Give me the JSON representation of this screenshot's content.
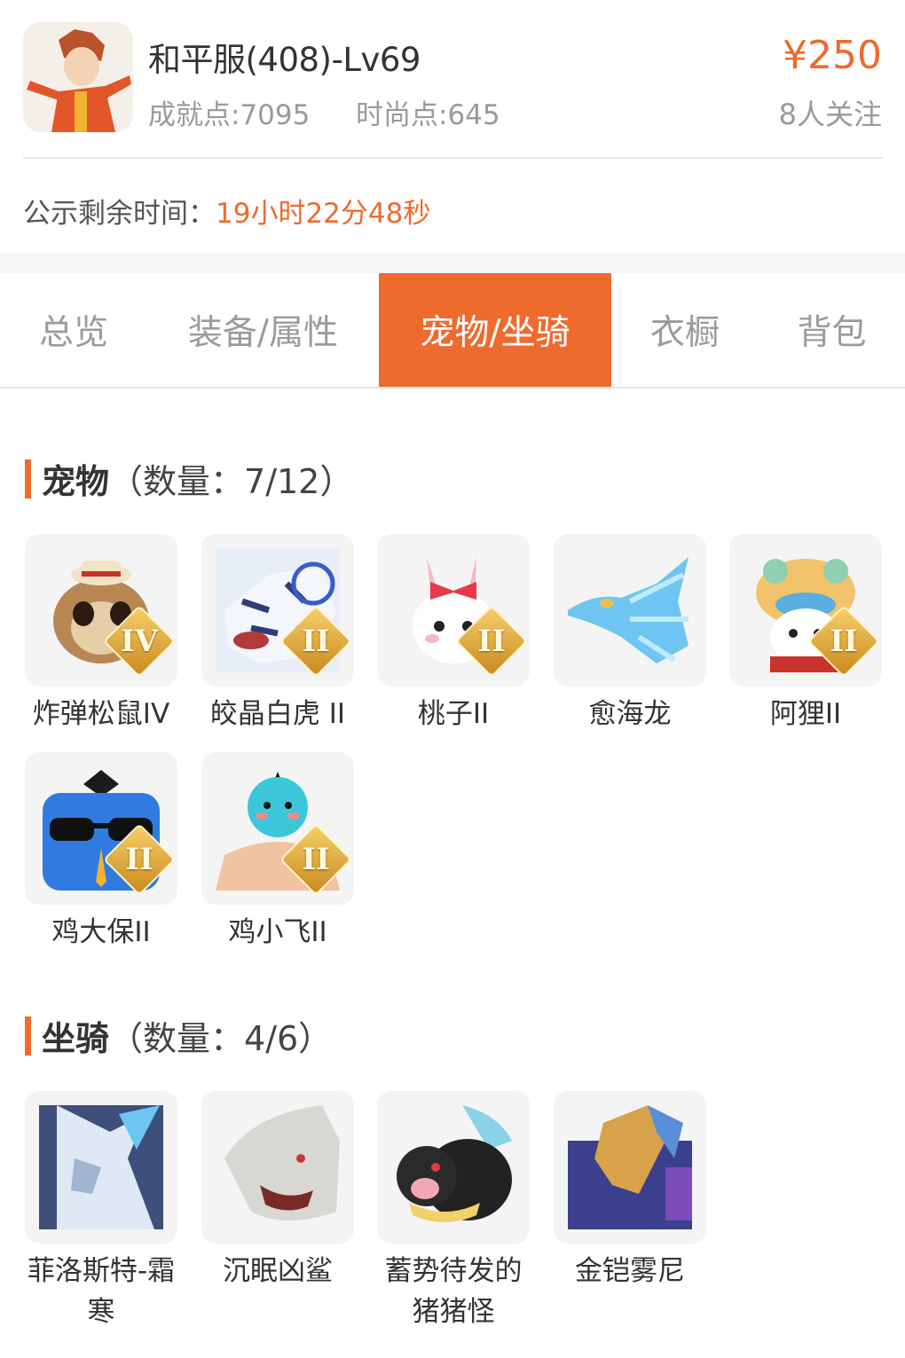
{
  "header": {
    "title": "和平服(408)-Lv69",
    "achievement": "成就点:7095",
    "fashion": "时尚点:645",
    "price": "¥250",
    "followers": "8人关注"
  },
  "countdown": {
    "label": "公示剩余时间：",
    "value": "19小时22分48秒"
  },
  "tabs": [
    {
      "label": "总览",
      "active": false
    },
    {
      "label": "装备/属性",
      "active": false
    },
    {
      "label": "宠物/坐骑",
      "active": true
    },
    {
      "label": "衣橱",
      "active": false
    },
    {
      "label": "背包",
      "active": false
    }
  ],
  "pets": {
    "title": "宠物",
    "count": "（数量：7/12）",
    "items": [
      {
        "name": "炸弹松鼠IV",
        "badge": "IV",
        "icon": "squirrel-icon"
      },
      {
        "name": "皎晶白虎 II",
        "badge": "II",
        "icon": "white-tiger-icon"
      },
      {
        "name": "桃子II",
        "badge": "II",
        "icon": "bunny-icon"
      },
      {
        "name": "愈海龙",
        "badge": "",
        "icon": "sea-dragon-icon"
      },
      {
        "name": "阿狸II",
        "badge": "II",
        "icon": "lion-dance-icon"
      },
      {
        "name": "鸡大保II",
        "badge": "II",
        "icon": "blue-bird-icon"
      },
      {
        "name": "鸡小飞II",
        "badge": "II",
        "icon": "chick-icon"
      }
    ]
  },
  "mounts": {
    "title": "坐骑",
    "count": "（数量：4/6）",
    "items": [
      {
        "name": "菲洛斯特-霜寒",
        "icon": "frost-dragon-icon"
      },
      {
        "name": "沉眠凶鲨",
        "icon": "shark-icon"
      },
      {
        "name": "蓄势待发的猪猪怪",
        "icon": "pig-icon"
      },
      {
        "name": "金铠雾尼",
        "icon": "armored-bird-icon"
      }
    ]
  },
  "colors": {
    "accent": "#ee6b2d",
    "text": "#333333",
    "muted": "#9a9a9a"
  }
}
